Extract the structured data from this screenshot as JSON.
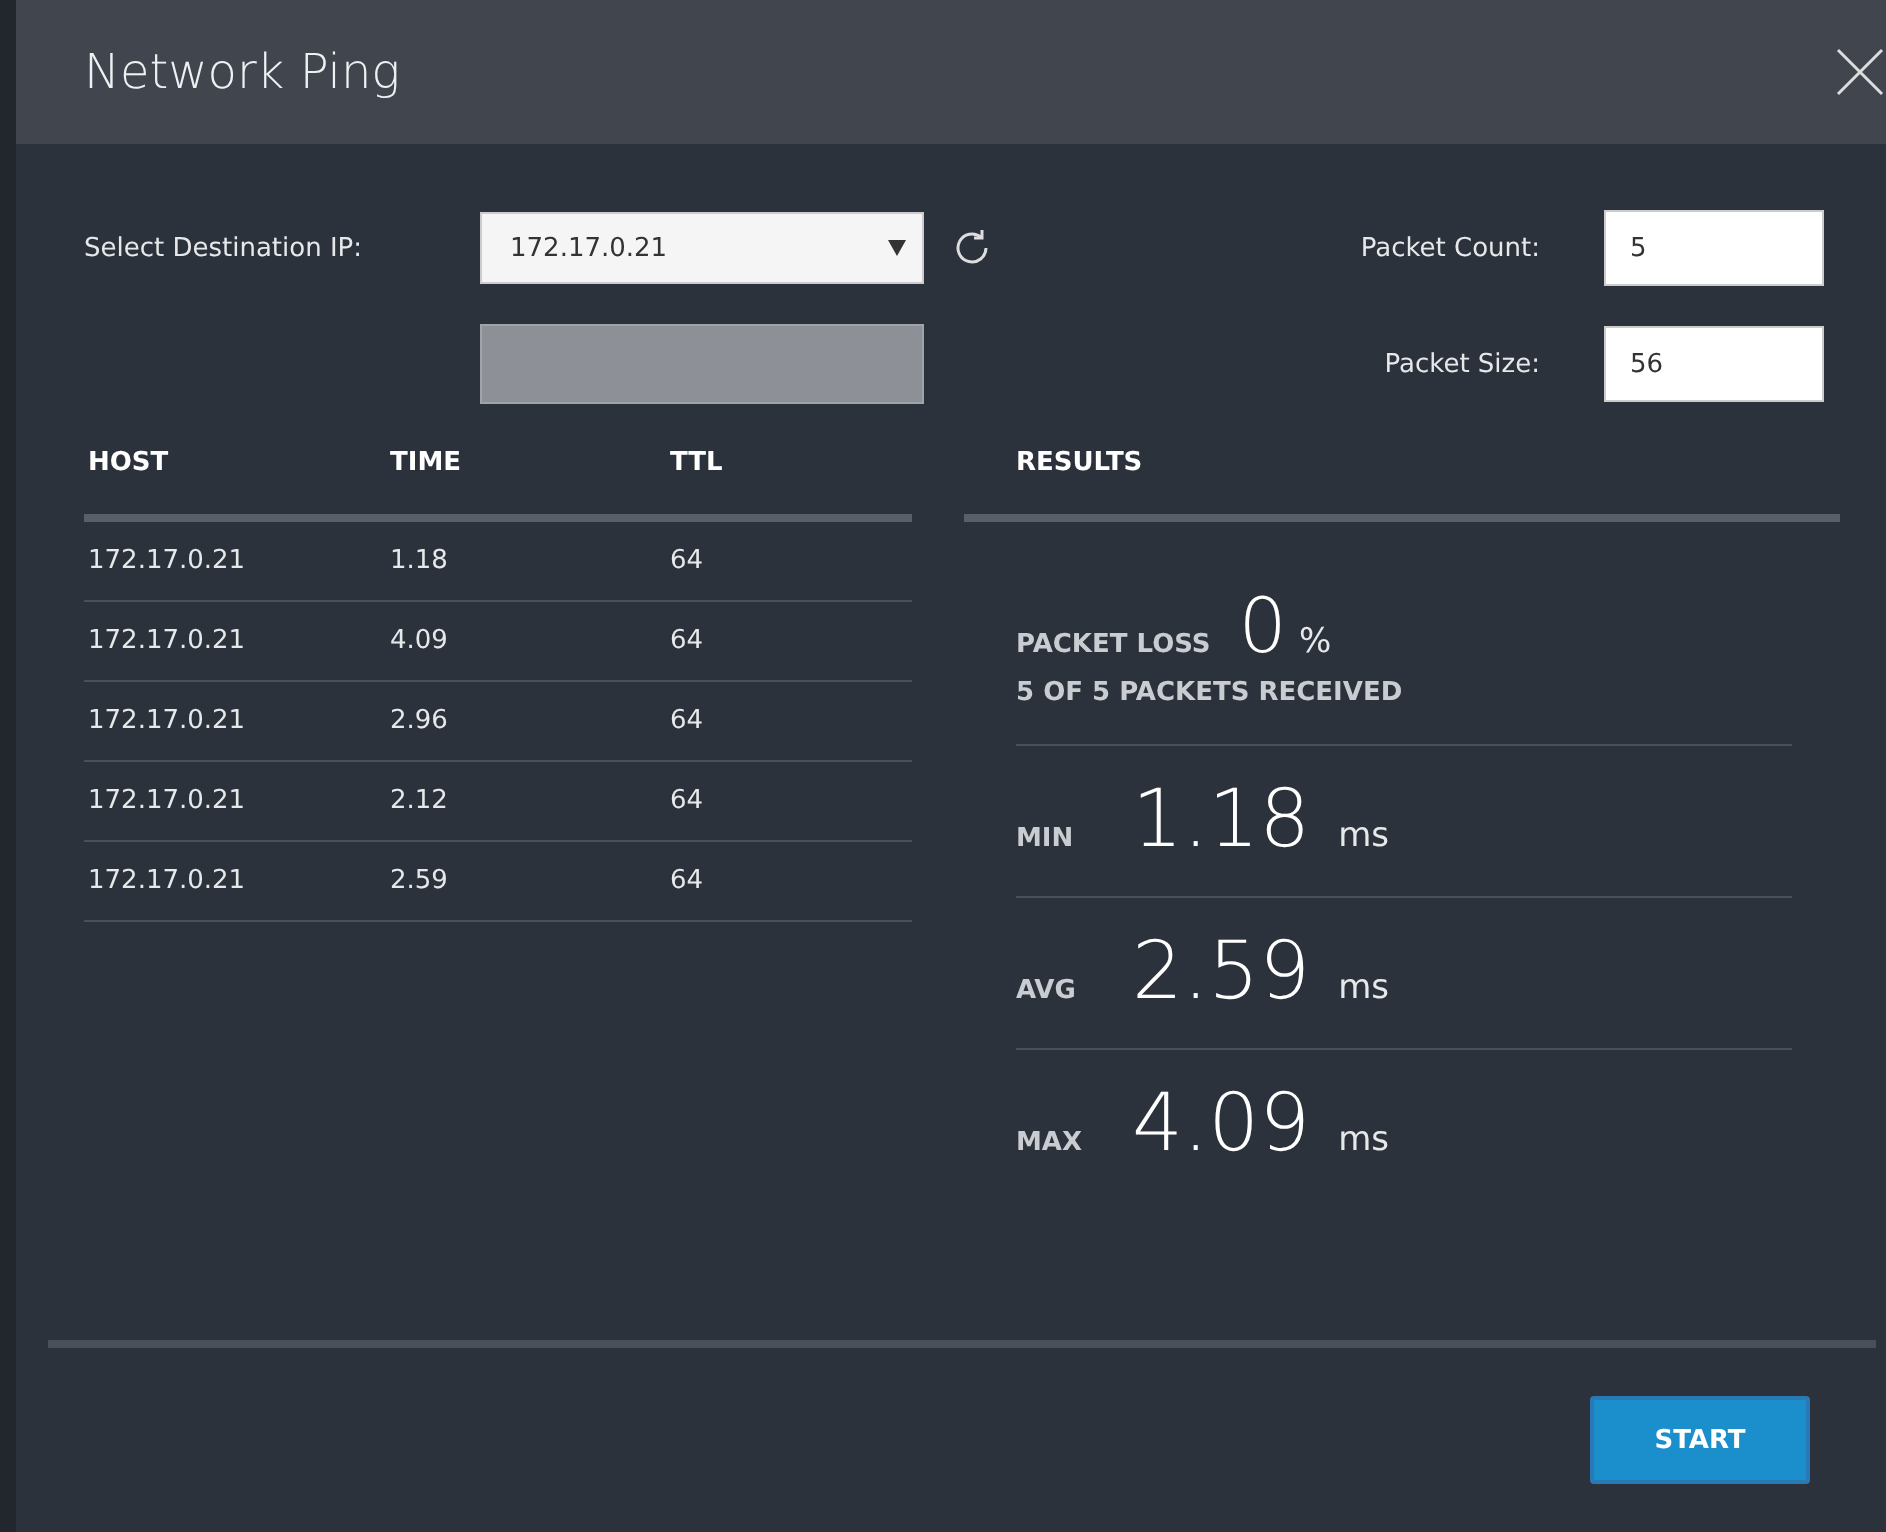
{
  "dialog": {
    "title": "Network Ping"
  },
  "form": {
    "destination_label": "Select Destination IP:",
    "destination_value": "172.17.0.21",
    "count_label": "Packet Count:",
    "count_value": "5",
    "size_label": "Packet Size:",
    "size_value": "56"
  },
  "table": {
    "columns": [
      "HOST",
      "TIME",
      "TTL"
    ],
    "rows": [
      [
        "172.17.0.21",
        "1.18",
        "64"
      ],
      [
        "172.17.0.21",
        "4.09",
        "64"
      ],
      [
        "172.17.0.21",
        "2.96",
        "64"
      ],
      [
        "172.17.0.21",
        "2.12",
        "64"
      ],
      [
        "172.17.0.21",
        "2.59",
        "64"
      ]
    ]
  },
  "results": {
    "heading": "RESULTS",
    "loss_label": "PACKET LOSS",
    "loss_value": "0",
    "loss_unit": "%",
    "received": "5 OF 5 PACKETS RECEIVED",
    "stats": [
      {
        "label": "MIN",
        "value": "1.18",
        "unit": "ms"
      },
      {
        "label": "AVG",
        "value": "2.59",
        "unit": "ms"
      },
      {
        "label": "MAX",
        "value": "4.09",
        "unit": "ms"
      }
    ]
  },
  "buttons": [
    "START"
  ]
}
